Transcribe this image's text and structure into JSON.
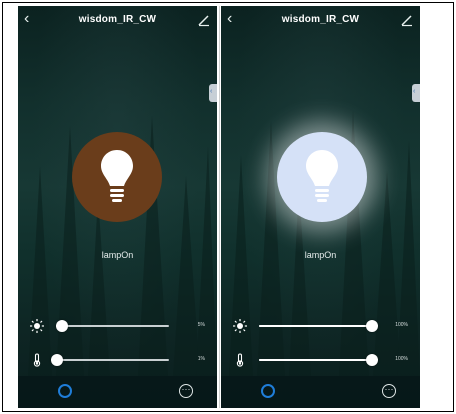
{
  "screens": [
    {
      "header": {
        "title": "wisdom_IR_CW",
        "back_icon": "back-chevron-icon",
        "edit_icon": "edit-pencil-icon"
      },
      "lamp": {
        "label": "lampOn",
        "state": "off",
        "circle_color": "#6a3d1b"
      },
      "brightness": {
        "value": 0.05,
        "display": "5%",
        "icon": "sun-icon"
      },
      "color_temp": {
        "value": 0.01,
        "display": "1%",
        "icon": "thermometer-icon"
      },
      "bottom": {
        "power_icon": "power-circle-icon",
        "more_icon": "more-dots-icon"
      }
    },
    {
      "header": {
        "title": "wisdom_IR_CW",
        "back_icon": "back-chevron-icon",
        "edit_icon": "edit-pencil-icon"
      },
      "lamp": {
        "label": "lampOn",
        "state": "on",
        "circle_color": "#d5e1f7"
      },
      "brightness": {
        "value": 1.0,
        "display": "100%",
        "icon": "sun-icon"
      },
      "color_temp": {
        "value": 1.0,
        "display": "100%",
        "icon": "thermometer-icon"
      },
      "bottom": {
        "power_icon": "power-circle-icon",
        "more_icon": "more-dots-icon"
      }
    }
  ],
  "colors": {
    "accent": "#1f7dd8",
    "background": "#12302d",
    "text": "#ffffff"
  }
}
